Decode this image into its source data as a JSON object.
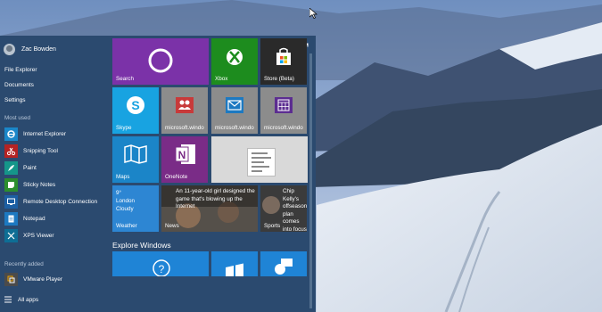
{
  "user": {
    "name": "Zac Bowden"
  },
  "places": {
    "file_explorer": "File Explorer",
    "documents": "Documents",
    "settings": "Settings"
  },
  "most_used": {
    "label": "Most used",
    "items": [
      {
        "label": "Internet Explorer",
        "icon": "internet-explorer-icon"
      },
      {
        "label": "Snipping Tool",
        "icon": "snipping-tool-icon"
      },
      {
        "label": "Paint",
        "icon": "paint-icon"
      },
      {
        "label": "Sticky Notes",
        "icon": "sticky-notes-icon"
      },
      {
        "label": "Remote Desktop Connection",
        "icon": "remote-desktop-icon"
      },
      {
        "label": "Notepad",
        "icon": "notepad-icon"
      },
      {
        "label": "XPS Viewer",
        "icon": "xps-viewer-icon"
      }
    ]
  },
  "recently_added": {
    "label": "Recently added",
    "items": [
      {
        "label": "VMware Player",
        "icon": "vmware-icon"
      }
    ]
  },
  "all_apps": {
    "label": "All apps"
  },
  "tiles": {
    "search": "Search",
    "xbox": "Xbox",
    "store": "Store (Beta)",
    "skype": "Skype",
    "people": "microsoft.windo",
    "mail": "microsoft.windo",
    "calendar": "microsoft.windo",
    "maps": "Maps",
    "onenote": "OneNote",
    "weather": {
      "label": "Weather",
      "temp": "9°",
      "city": "London",
      "condition": "Cloudy"
    },
    "news": {
      "label": "News",
      "headline": "An 11-year-old girl designed the game that's blowing up the Internet"
    },
    "sports": {
      "label": "Sports",
      "headline": "Chip Kelly's offseason plan comes into focus"
    }
  },
  "explore": {
    "title": "Explore Windows"
  },
  "colors": {
    "start_bg": "#2b4a6f",
    "search_tile": "#7b32a8",
    "xbox_tile": "#1d8c1e",
    "skype_tile": "#18a3e1",
    "onenote_tile": "#7a2c87",
    "accent_blue": "#1f84d6"
  }
}
